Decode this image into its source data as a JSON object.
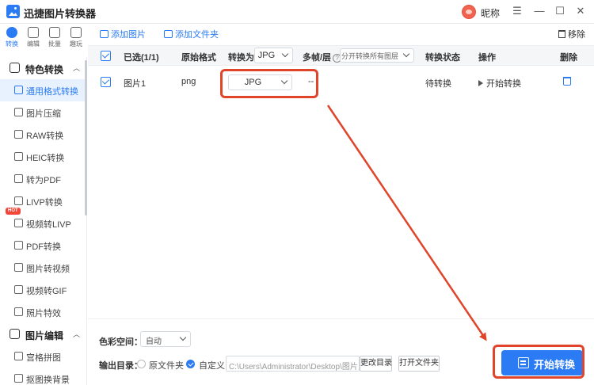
{
  "app": {
    "title": "迅捷图片转换器",
    "nickname": "昵称",
    "controls": {
      "skin": "☰",
      "menu": "≡",
      "minimize": "—",
      "maximize": "☐",
      "close": "✕"
    }
  },
  "icon_rail": [
    {
      "label": "转换",
      "active": true
    },
    {
      "label": "编辑",
      "active": false
    },
    {
      "label": "批量",
      "active": false
    },
    {
      "label": "趣玩",
      "active": false
    }
  ],
  "sidebar": {
    "group1": {
      "label": "特色转换",
      "caret": "︿"
    },
    "items": [
      {
        "label": "通用格式转换",
        "active": true
      },
      {
        "label": "图片压缩"
      },
      {
        "label": "RAW转换"
      },
      {
        "label": "HEIC转换"
      },
      {
        "label": "转为PDF"
      },
      {
        "label": "LIVP转换"
      },
      {
        "label": "视频转LIVP",
        "badge": "HOT"
      },
      {
        "label": "PDF转换"
      },
      {
        "label": "图片转视频"
      },
      {
        "label": "视频转GIF"
      },
      {
        "label": "照片特效"
      }
    ],
    "group2": {
      "label": "图片编辑",
      "caret": "︿"
    },
    "items2": [
      {
        "label": "宫格拼图"
      },
      {
        "label": "抠图换背景"
      }
    ]
  },
  "toolbar": {
    "add_image": "添加图片",
    "add_folder": "添加文件夹",
    "remove": "移除"
  },
  "table": {
    "headers": {
      "selected": "已选(1/1)",
      "original_format": "原始格式",
      "convert_to": "转换为",
      "convert_to_value": "JPG",
      "multiframe": "多帧/层",
      "multiframe_help": "?",
      "multiframe_select": "分开转换所有图层",
      "status": "转换状态",
      "action": "操作",
      "delete": "删除"
    },
    "rows": [
      {
        "name": "图片1",
        "format": "png",
        "target": "JPG",
        "multiframe": "--",
        "status": "待转换",
        "action": "开始转换"
      }
    ]
  },
  "bottom": {
    "color_space_label": "色彩空间：",
    "color_space_value": "自动",
    "output_label": "输出目录：",
    "opt_source": "原文件夹",
    "opt_custom": "自定义",
    "custom_selected": true,
    "path": "C:\\Users\\Administrator\\Desktop\\图片",
    "change_dir": "更改目录",
    "open_folder": "打开文件夹",
    "start": "开始转换"
  },
  "colors": {
    "accent": "#2a7bf4",
    "annotation": "#e0452c",
    "sidebar_active_bg": "#e8f1fe"
  }
}
